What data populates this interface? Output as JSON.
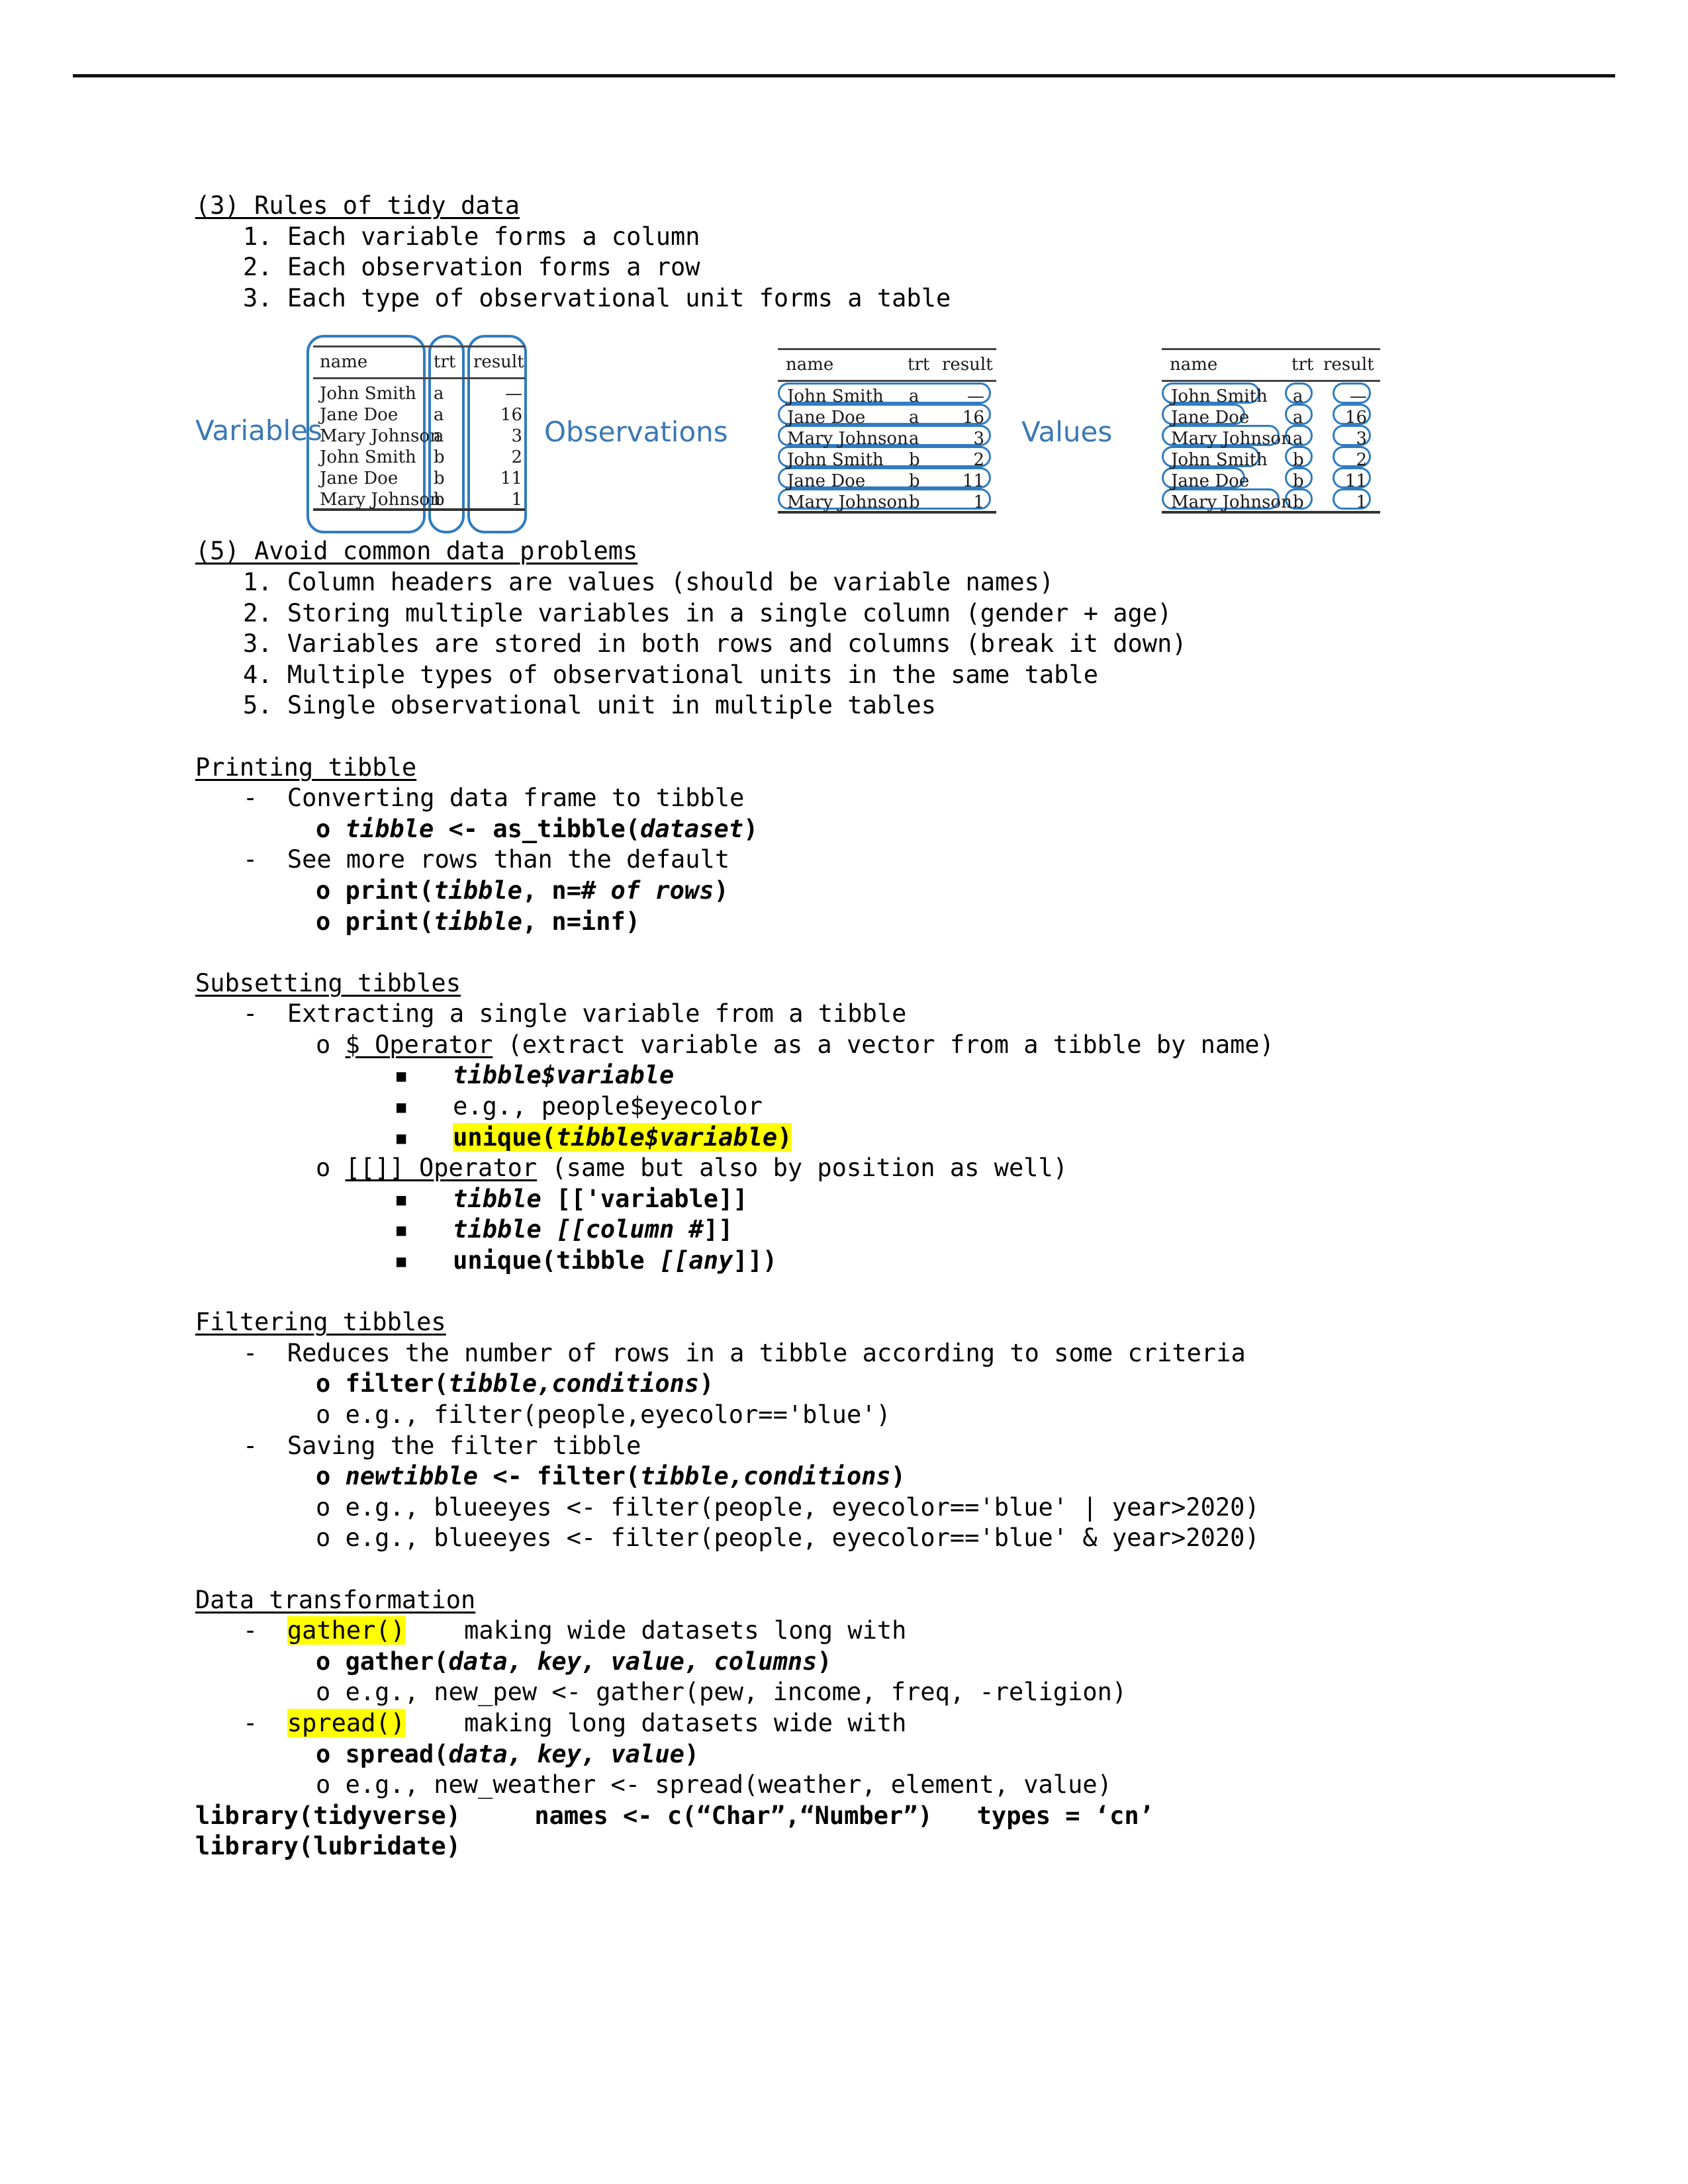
{
  "sections": {
    "rules": {
      "heading": "(3) Rules of tidy data",
      "items": [
        "1. Each variable forms a column",
        "2. Each observation forms a row",
        "3. Each type of observational unit forms a table"
      ]
    },
    "problems": {
      "heading": "(5) Avoid common data problems",
      "items": [
        "1. Column headers are values (should be variable names)",
        "2. Storing multiple variables in a single column (gender + age)",
        "3. Variables are stored in both rows and columns (break it down)",
        "4. Multiple types of observational units in the same table",
        "5. Single observational unit in multiple tables"
      ]
    },
    "printing": {
      "heading": "Printing tibble",
      "b1": "-  Converting data frame to tibble",
      "b1a_marker": "o",
      "b1a_p1": "tibble",
      "b1a_p2": " <- as_tibble(",
      "b1a_p3": "dataset",
      "b1a_p4": ")",
      "b2": "-  See more rows than the default",
      "b2a_marker": "o",
      "b2a_p1": "print(",
      "b2a_p2": "tibble",
      "b2a_p3": ", n=",
      "b2a_p4": "# of rows",
      "b2a_p5": ")",
      "b2b_marker": "o",
      "b2b_p1": "print(",
      "b2b_p2": "tibble",
      "b2b_p3": ", n=inf)"
    },
    "subsetting": {
      "heading": "Subsetting tibbles",
      "b1": "-  Extracting a single variable from a tibble",
      "op1_marker": "o",
      "op1_name": "$ Operator",
      "op1_desc": " (extract variable as a vector from a tibble by name)",
      "op1_i1_p1": "tibble$variable",
      "op1_i2": "e.g., people$eyecolor",
      "op1_i3_p1": "unique(",
      "op1_i3_p2": "tibble$variable",
      "op1_i3_p3": ")",
      "op2_marker": "o",
      "op2_name": "[[]] Operator",
      "op2_desc": " (same but also by position as well)",
      "op2_i1_p1": "tibble ",
      "op2_i1_p2": "[['variable",
      "op2_i1_p3": "]]",
      "op2_i2_p1": "tibble ",
      "op2_i2_p2": "[[column #",
      "op2_i2_p3": "]]",
      "op2_i3_p1": "unique(tibble ",
      "op2_i3_p2": "[[any",
      "op2_i3_p3": "]])"
    },
    "filtering": {
      "heading": "Filtering tibbles",
      "b1": "-  Reduces the number of rows in a tibble according to some criteria",
      "b1a_marker": "o",
      "b1a_p1": "filter(",
      "b1a_p2": "tibble,conditions",
      "b1a_p3": ")",
      "b1b_marker": "o",
      "b1b": "e.g., filter(people,eyecolor=='blue')",
      "b2": "-  Saving the filter tibble",
      "b2a_marker": "o",
      "b2a_p1": "newtibble",
      "b2a_p2": " <- filter(",
      "b2a_p3": "tibble,conditions",
      "b2a_p4": ")",
      "b2b_marker": "o",
      "b2b": "e.g., blueeyes <- filter(people, eyecolor=='blue' | year>2020)",
      "b2c_marker": "o",
      "b2c": "e.g., blueeyes <- filter(people, eyecolor=='blue' & year>2020)"
    },
    "transform": {
      "heading": "Data transformation",
      "g_dash": "-  ",
      "g_name": "gather()",
      "g_desc": "    making wide datasets long with",
      "g_a_marker": "o",
      "g_a_p1": "gather(",
      "g_a_p2": "data, key, value, columns",
      "g_a_p3": ")",
      "g_b_marker": "o",
      "g_b": "e.g., new_pew <- gather(pew, income, freq, -religion)",
      "s_dash": "-  ",
      "s_name": "spread()",
      "s_desc": "    making long datasets wide with",
      "s_a_marker": "o",
      "s_a_p1": "spread(",
      "s_a_p2": "data, key, value",
      "s_a_p3": ")",
      "s_b_marker": "o",
      "s_b": "e.g., new_weather <- spread(weather, element, value)"
    },
    "footer": {
      "line1_a": "library(tidyverse)",
      "line1_b": "names <- c(“Char”,“Number”)",
      "line1_c": "types = ‘cn’",
      "line2": "library(lubridate)"
    }
  },
  "diagram": {
    "accent": "#3a78b5",
    "labels": {
      "variables": "Variables",
      "observations": "Observations",
      "values": "Values"
    },
    "columns": [
      "name",
      "trt",
      "result"
    ],
    "rows": [
      {
        "name": "John Smith",
        "trt": "a",
        "result": "—"
      },
      {
        "name": "Jane Doe",
        "trt": "a",
        "result": "16"
      },
      {
        "name": "Mary Johnson",
        "trt": "a",
        "result": "3"
      },
      {
        "name": "John Smith",
        "trt": "b",
        "result": "2"
      },
      {
        "name": "Jane Doe",
        "trt": "b",
        "result": "11"
      },
      {
        "name": "Mary Johnson",
        "trt": "b",
        "result": "1"
      }
    ],
    "highlight_modes": [
      "columns",
      "rows",
      "cells"
    ]
  }
}
